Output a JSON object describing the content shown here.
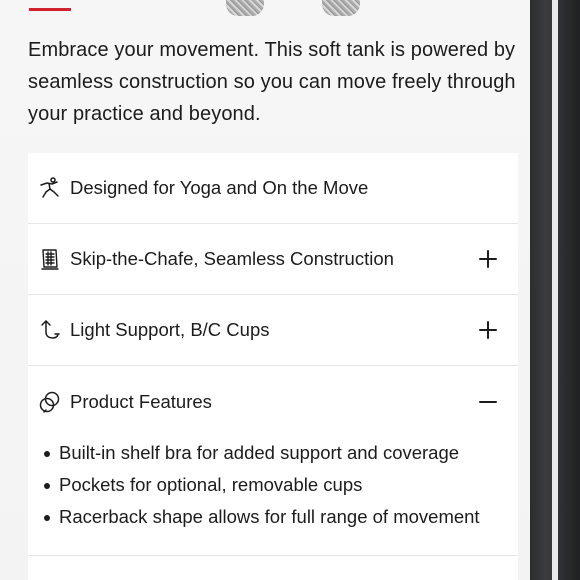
{
  "description": "Embrace your movement. This soft tank is powered by seamless construction so you can move freely through your practice and beyond.",
  "accordion": {
    "items": [
      {
        "label": "Designed for Yoga and On the Move",
        "icon": "yoga-pose-icon",
        "toggle": "none"
      },
      {
        "label": "Skip-the-Chafe, Seamless Construction",
        "icon": "fabric-swatch-icon",
        "toggle": "plus"
      },
      {
        "label": "Light Support, B/C Cups",
        "icon": "support-curve-icon",
        "toggle": "plus"
      },
      {
        "label": "Product Features",
        "icon": "overlap-circles-icon",
        "toggle": "minus"
      }
    ],
    "features": [
      "Built-in shelf bra for added support and coverage",
      "Pockets for optional, removable cups",
      "Racerback shape allows for full range of movement"
    ]
  },
  "colors": {
    "accent": "#d2202f",
    "text": "#1c1c1c",
    "divider": "#e6e6e6"
  }
}
